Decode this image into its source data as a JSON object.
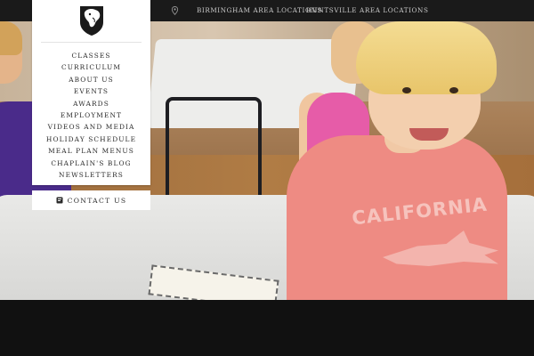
{
  "topbar": {
    "location_icon": "map-pin-icon",
    "links": [
      {
        "label": "BIRMINGHAM AREA LOCATIONS"
      },
      {
        "label": "HUNTSVILLE AREA LOCATIONS"
      }
    ]
  },
  "brand": {
    "logo_icon": "panther-shield-logo"
  },
  "nav": {
    "items": [
      {
        "label": "CLASSES"
      },
      {
        "label": "CURRICULUM"
      },
      {
        "label": "ABOUT US"
      },
      {
        "label": "EVENTS"
      },
      {
        "label": "AWARDS"
      },
      {
        "label": "EMPLOYMENT"
      },
      {
        "label": "VIDEOS AND MEDIA"
      },
      {
        "label": "HOLIDAY SCHEDULE"
      },
      {
        "label": "MEAL PLAN MENUS"
      },
      {
        "label": "CHAPLAIN'S BLOG"
      },
      {
        "label": "NEWSLETTERS"
      }
    ],
    "contact": {
      "label": "CONTACT US",
      "icon": "phone-book-icon"
    }
  },
  "hero": {
    "shirt_text": "CALIFORNIA"
  },
  "colors": {
    "topbar_bg": "#1a1a1a",
    "panel_bg": "#ffffff",
    "nav_text": "#2b2b2b",
    "bottom_band": "#111111"
  }
}
